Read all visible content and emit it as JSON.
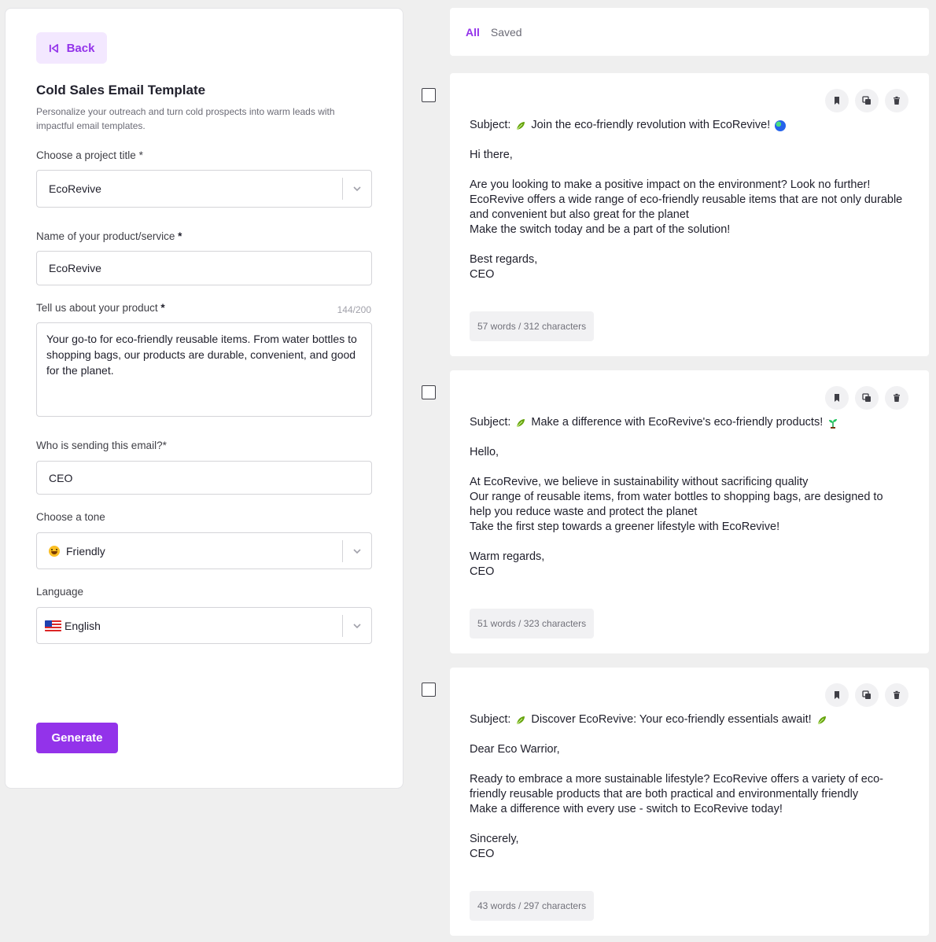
{
  "left": {
    "back_label": "Back",
    "title": "Cold Sales Email Template",
    "subtitle": "Personalize your outreach and turn cold prospects into warm leads with impactful email templates.",
    "project_label": "Choose a project title",
    "project_value": "EcoRevive",
    "product_name_label": "Name of your product/service",
    "product_name_value": "EcoRevive",
    "about_label": "Tell us about your product",
    "about_counter": "144/200",
    "about_value": "Your go-to for eco-friendly reusable items. From water bottles to shopping bags, our products are durable, convenient, and good for the planet.",
    "sender_label": "Who is sending this email?*",
    "sender_value": "CEO",
    "tone_label": "Choose a tone",
    "tone_value": "Friendly",
    "language_label": "Language",
    "language_value": "English",
    "required_mark": "*",
    "generate_label": "Generate"
  },
  "tabs": [
    {
      "label": "All",
      "active": true
    },
    {
      "label": "Saved",
      "active": false
    }
  ],
  "results": [
    {
      "subject_prefix": "Subject:",
      "subject": "Join the eco-friendly revolution with EcoRevive!",
      "lines": [
        "Hi there,",
        "",
        "Are you looking to make a positive impact on the environment? Look no further!",
        "EcoRevive offers a wide range of eco-friendly reusable items that are not only durable",
        "and convenient but also great for the planet",
        "Make the switch today and be a part of the solution!",
        "",
        "Best regards,",
        "CEO"
      ],
      "stats": "57 words / 312 characters"
    },
    {
      "subject_prefix": "Subject:",
      "subject": "Make a difference with EcoRevive's eco-friendly products!",
      "lines": [
        "Hello,",
        "",
        "At EcoRevive, we believe in sustainability without sacrificing quality",
        "Our range of reusable items, from water bottles to shopping bags, are designed to",
        "help you reduce waste and protect the planet",
        "Take the first step towards a greener lifestyle with EcoRevive!",
        "",
        "Warm regards,",
        "CEO"
      ],
      "stats": "51 words / 323 characters"
    },
    {
      "subject_prefix": "Subject:",
      "subject": "Discover EcoRevive: Your eco-friendly essentials await!",
      "lines": [
        "Dear Eco Warrior,",
        "",
        "Ready to embrace a more sustainable lifestyle? EcoRevive offers a variety of eco-",
        "friendly reusable products that are both practical and environmentally friendly",
        "Make a difference with every use - switch to EcoRevive today!",
        "",
        "Sincerely,",
        "CEO"
      ],
      "stats": "43 words / 297 characters"
    }
  ],
  "colors": {
    "accent": "#9333ea",
    "accent_soft": "#f3e8ff",
    "background": "#efefef"
  },
  "icons": [
    "back-to-start-icon",
    "chevron-down-icon",
    "smile-emoji-icon",
    "us-flag-icon",
    "bookmark-icon",
    "copy-icon",
    "trash-icon",
    "leaf-icon",
    "globe-icon",
    "sprout-icon"
  ]
}
